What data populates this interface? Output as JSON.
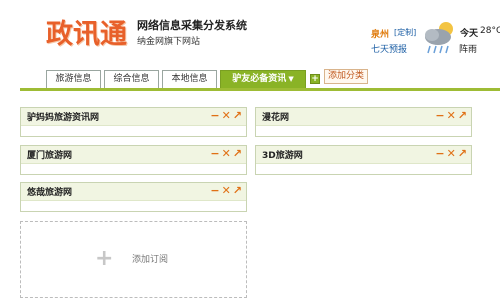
{
  "header": {
    "logo_text": "政讯通",
    "system_title": "网络信息采集分发系统",
    "system_subtitle": "纳金网旗下网站"
  },
  "weather": {
    "city": "泉州",
    "customize_label": "[定制]",
    "forecast_link": "七天预报",
    "today_label": "今天",
    "temperature": "28°C",
    "condition": "阵雨",
    "icon": "cloud-rain-icon"
  },
  "tabs": [
    {
      "label": "旅游信息",
      "active": false
    },
    {
      "label": "综合信息",
      "active": false
    },
    {
      "label": "本地信息",
      "active": false
    },
    {
      "label": "驴友必备资讯",
      "active": true
    }
  ],
  "add_category_label": "添加分类",
  "panels": [
    {
      "title": "驴妈妈旅游资讯网"
    },
    {
      "title": "厦门旅游网"
    },
    {
      "title": "悠哉旅游网"
    },
    {
      "title": "漫花网"
    },
    {
      "title": "3D旅游网"
    }
  ],
  "panel_controls": {
    "minimize": "−",
    "close": "✕",
    "popout": "↗"
  },
  "add_subscription_label": "添加订阅",
  "colors": {
    "accent_green": "#8ab326",
    "logo_orange": "#e8602a",
    "control_orange": "#e07015"
  }
}
